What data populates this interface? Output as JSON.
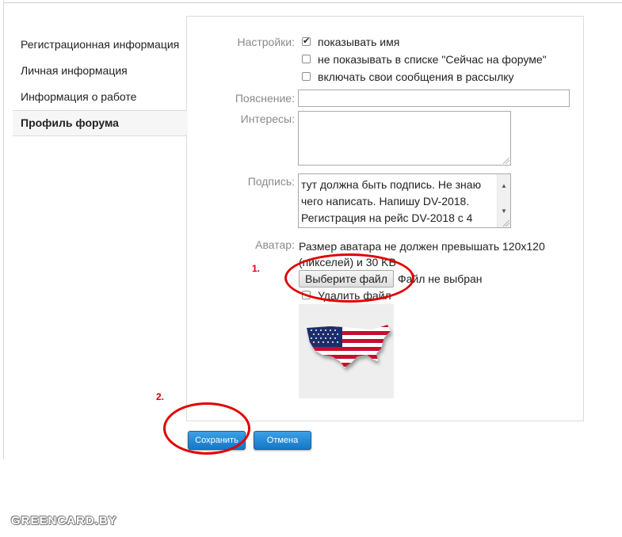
{
  "sidebar": {
    "items": [
      {
        "label": "Регистрационная информация"
      },
      {
        "label": "Личная информация"
      },
      {
        "label": "Информация о работе"
      },
      {
        "label": "Профиль форума"
      }
    ]
  },
  "form": {
    "settings_label": "Настройки:",
    "settings_options": [
      {
        "label": "показывать имя",
        "checked": true
      },
      {
        "label": "не показывать в списке \"Сейчас на форуме\"",
        "checked": false
      },
      {
        "label": "включать свои сообщения в рассылку",
        "checked": false
      }
    ],
    "explanation_label": "Пояснение:",
    "explanation_value": "",
    "interests_label": "Интересы:",
    "interests_value": "",
    "signature_label": "Подпись:",
    "signature_value": "тут должна быть подпись. Не знаю чего написать. Напишу DV-2018. Регистрация на рейс DV-2018 с 4",
    "avatar_label": "Аватар:",
    "avatar_hint": "Размер аватара не должен превышать 120x120 (пикселей) и 30 KB",
    "file_button_label": "Выберите файл",
    "file_status": "Файл не выбран",
    "delete_file_label": "Удалить файл",
    "delete_file_checked": false,
    "avatar_image": "usa-flag-map-image"
  },
  "buttons": {
    "save_label": "Сохранить",
    "cancel_label": "Отмена"
  },
  "annotations": {
    "marker_1": "1.",
    "marker_2": "2.",
    "color": "#e00000"
  },
  "watermark": "GREENCARD.BY",
  "colors": {
    "accent_button": "#1f87d6",
    "label_gray": "#8a8a8a",
    "border": "#dcdcdc"
  }
}
